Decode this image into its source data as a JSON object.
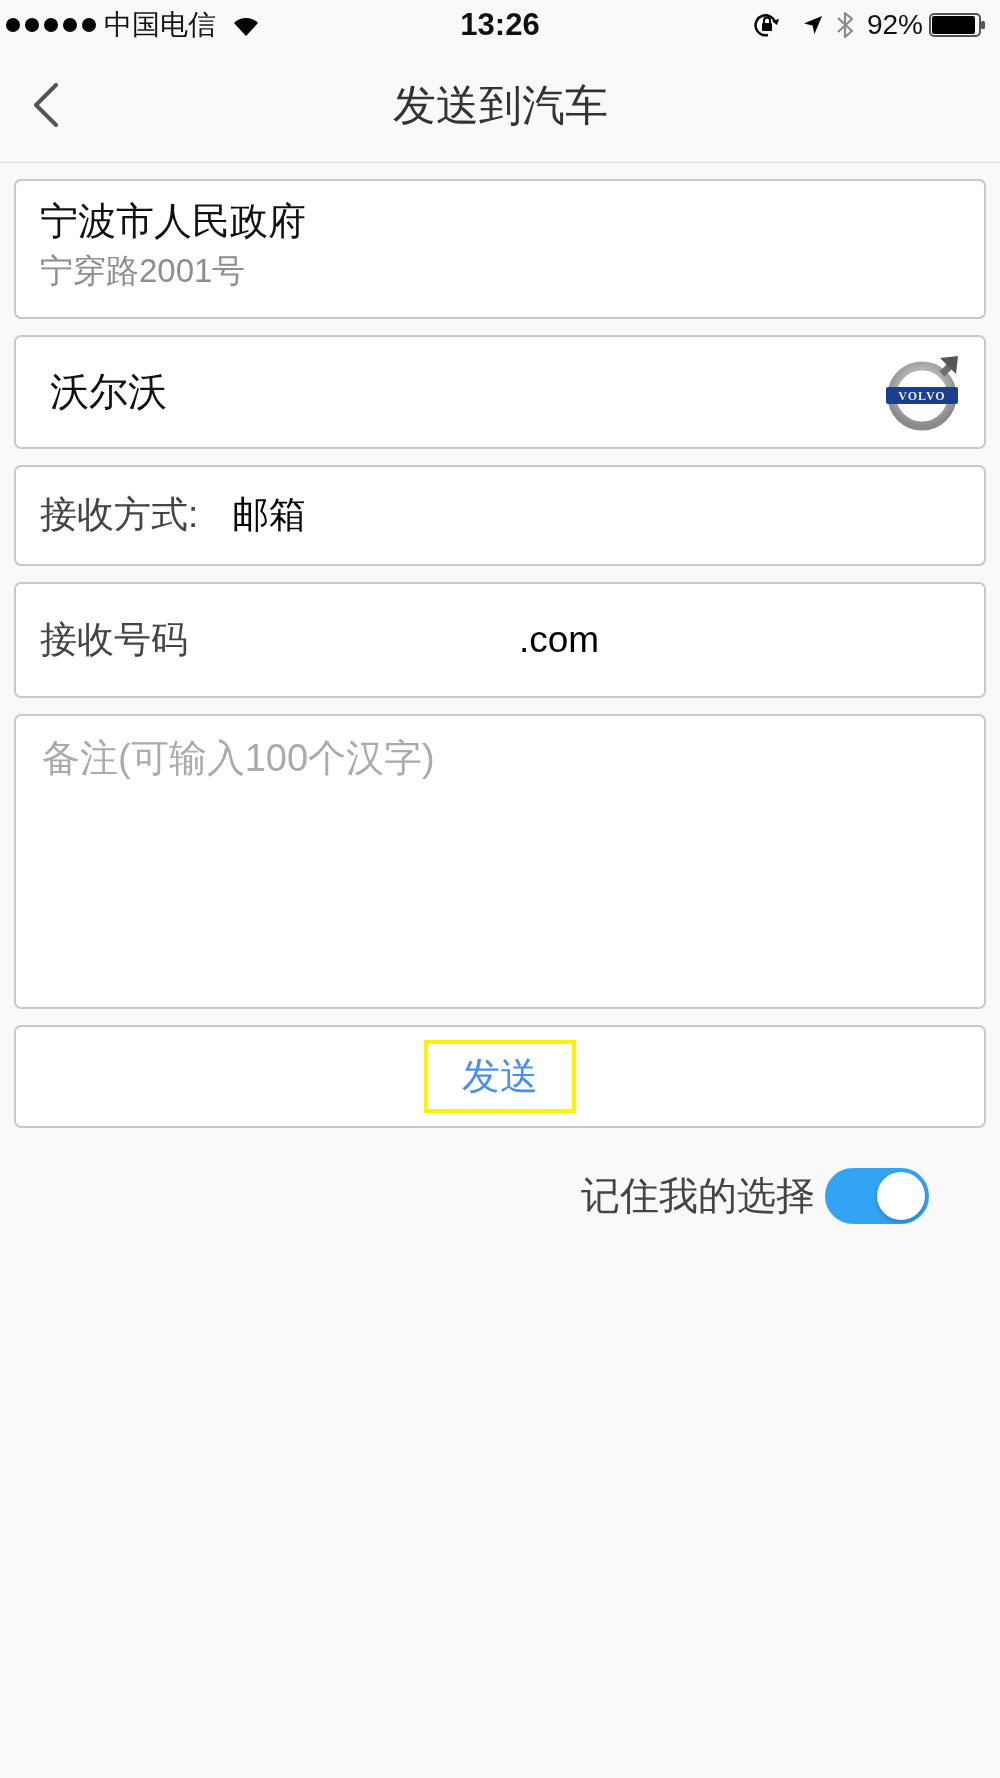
{
  "status_bar": {
    "carrier": "中国电信",
    "time": "13:26",
    "battery": "92%"
  },
  "nav": {
    "title": "发送到汽车"
  },
  "destination": {
    "name": "宁波市人民政府",
    "address": "宁穿路2001号"
  },
  "car": {
    "brand": "沃尔沃",
    "logo_text": "VOLVO"
  },
  "receive_method": {
    "label": "接收方式:",
    "value": "邮箱"
  },
  "receive_number": {
    "label": "接收号码",
    "value": ".com"
  },
  "remark": {
    "placeholder": "备注(可输入100个汉字)"
  },
  "send_button": {
    "label": "发送",
    "highlighted": true
  },
  "remember": {
    "label": "记住我的选择",
    "on": true
  }
}
